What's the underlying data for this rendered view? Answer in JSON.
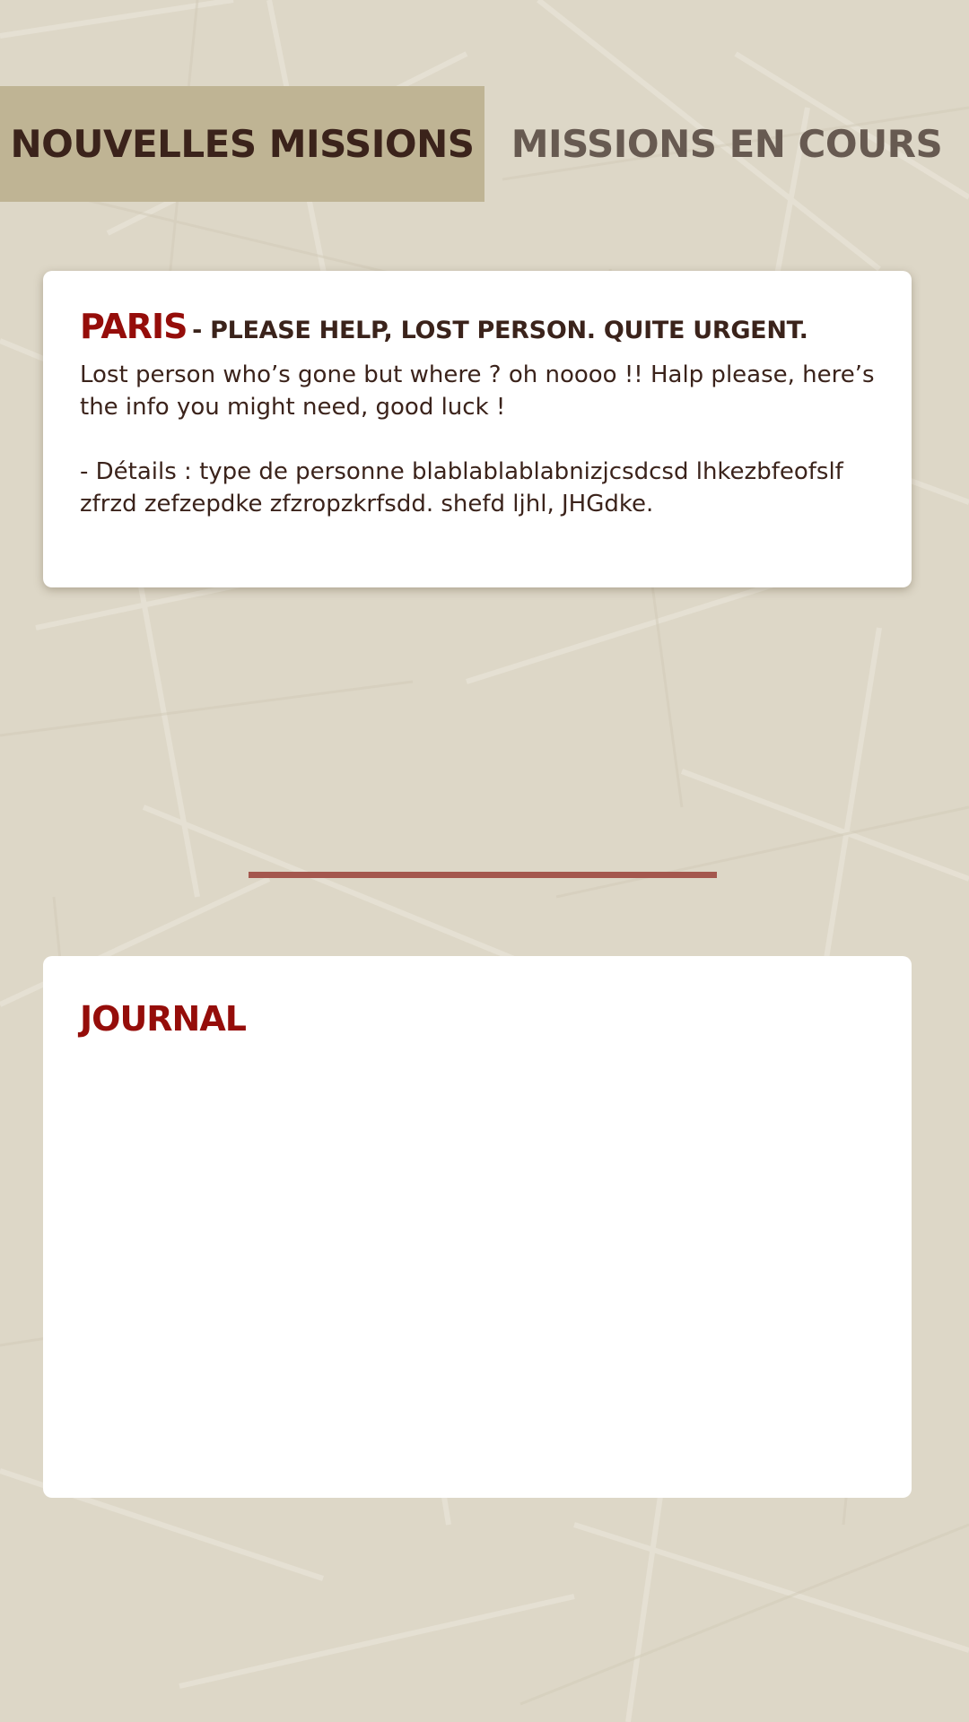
{
  "tabs": [
    {
      "label": "Nouvelles missions",
      "active": true
    },
    {
      "label": "Missions en cours",
      "active": false
    }
  ],
  "mission": {
    "city": "Paris",
    "headline": "- Please help, lost person. Quite urgent.",
    "description": "Lost person who’s gone but where ? oh noooo !! Halp please, here’s the info you might need, good luck !",
    "details": "- Détails : type de personne blablablablabnizjcsdcsd lhkezbfeofslf zfrzd zefzepdke zfzropzkrfsdd. shefd ljhl, JHGdke."
  },
  "journal": {
    "title": "Journal"
  },
  "colors": {
    "background": "#ddd7c7",
    "active_tab": "#bfb494",
    "dark_text": "#3b231b",
    "inactive_tab_text": "#675a51",
    "accent_red": "#950d0a",
    "divider": "#a4574e",
    "card": "#ffffff"
  }
}
